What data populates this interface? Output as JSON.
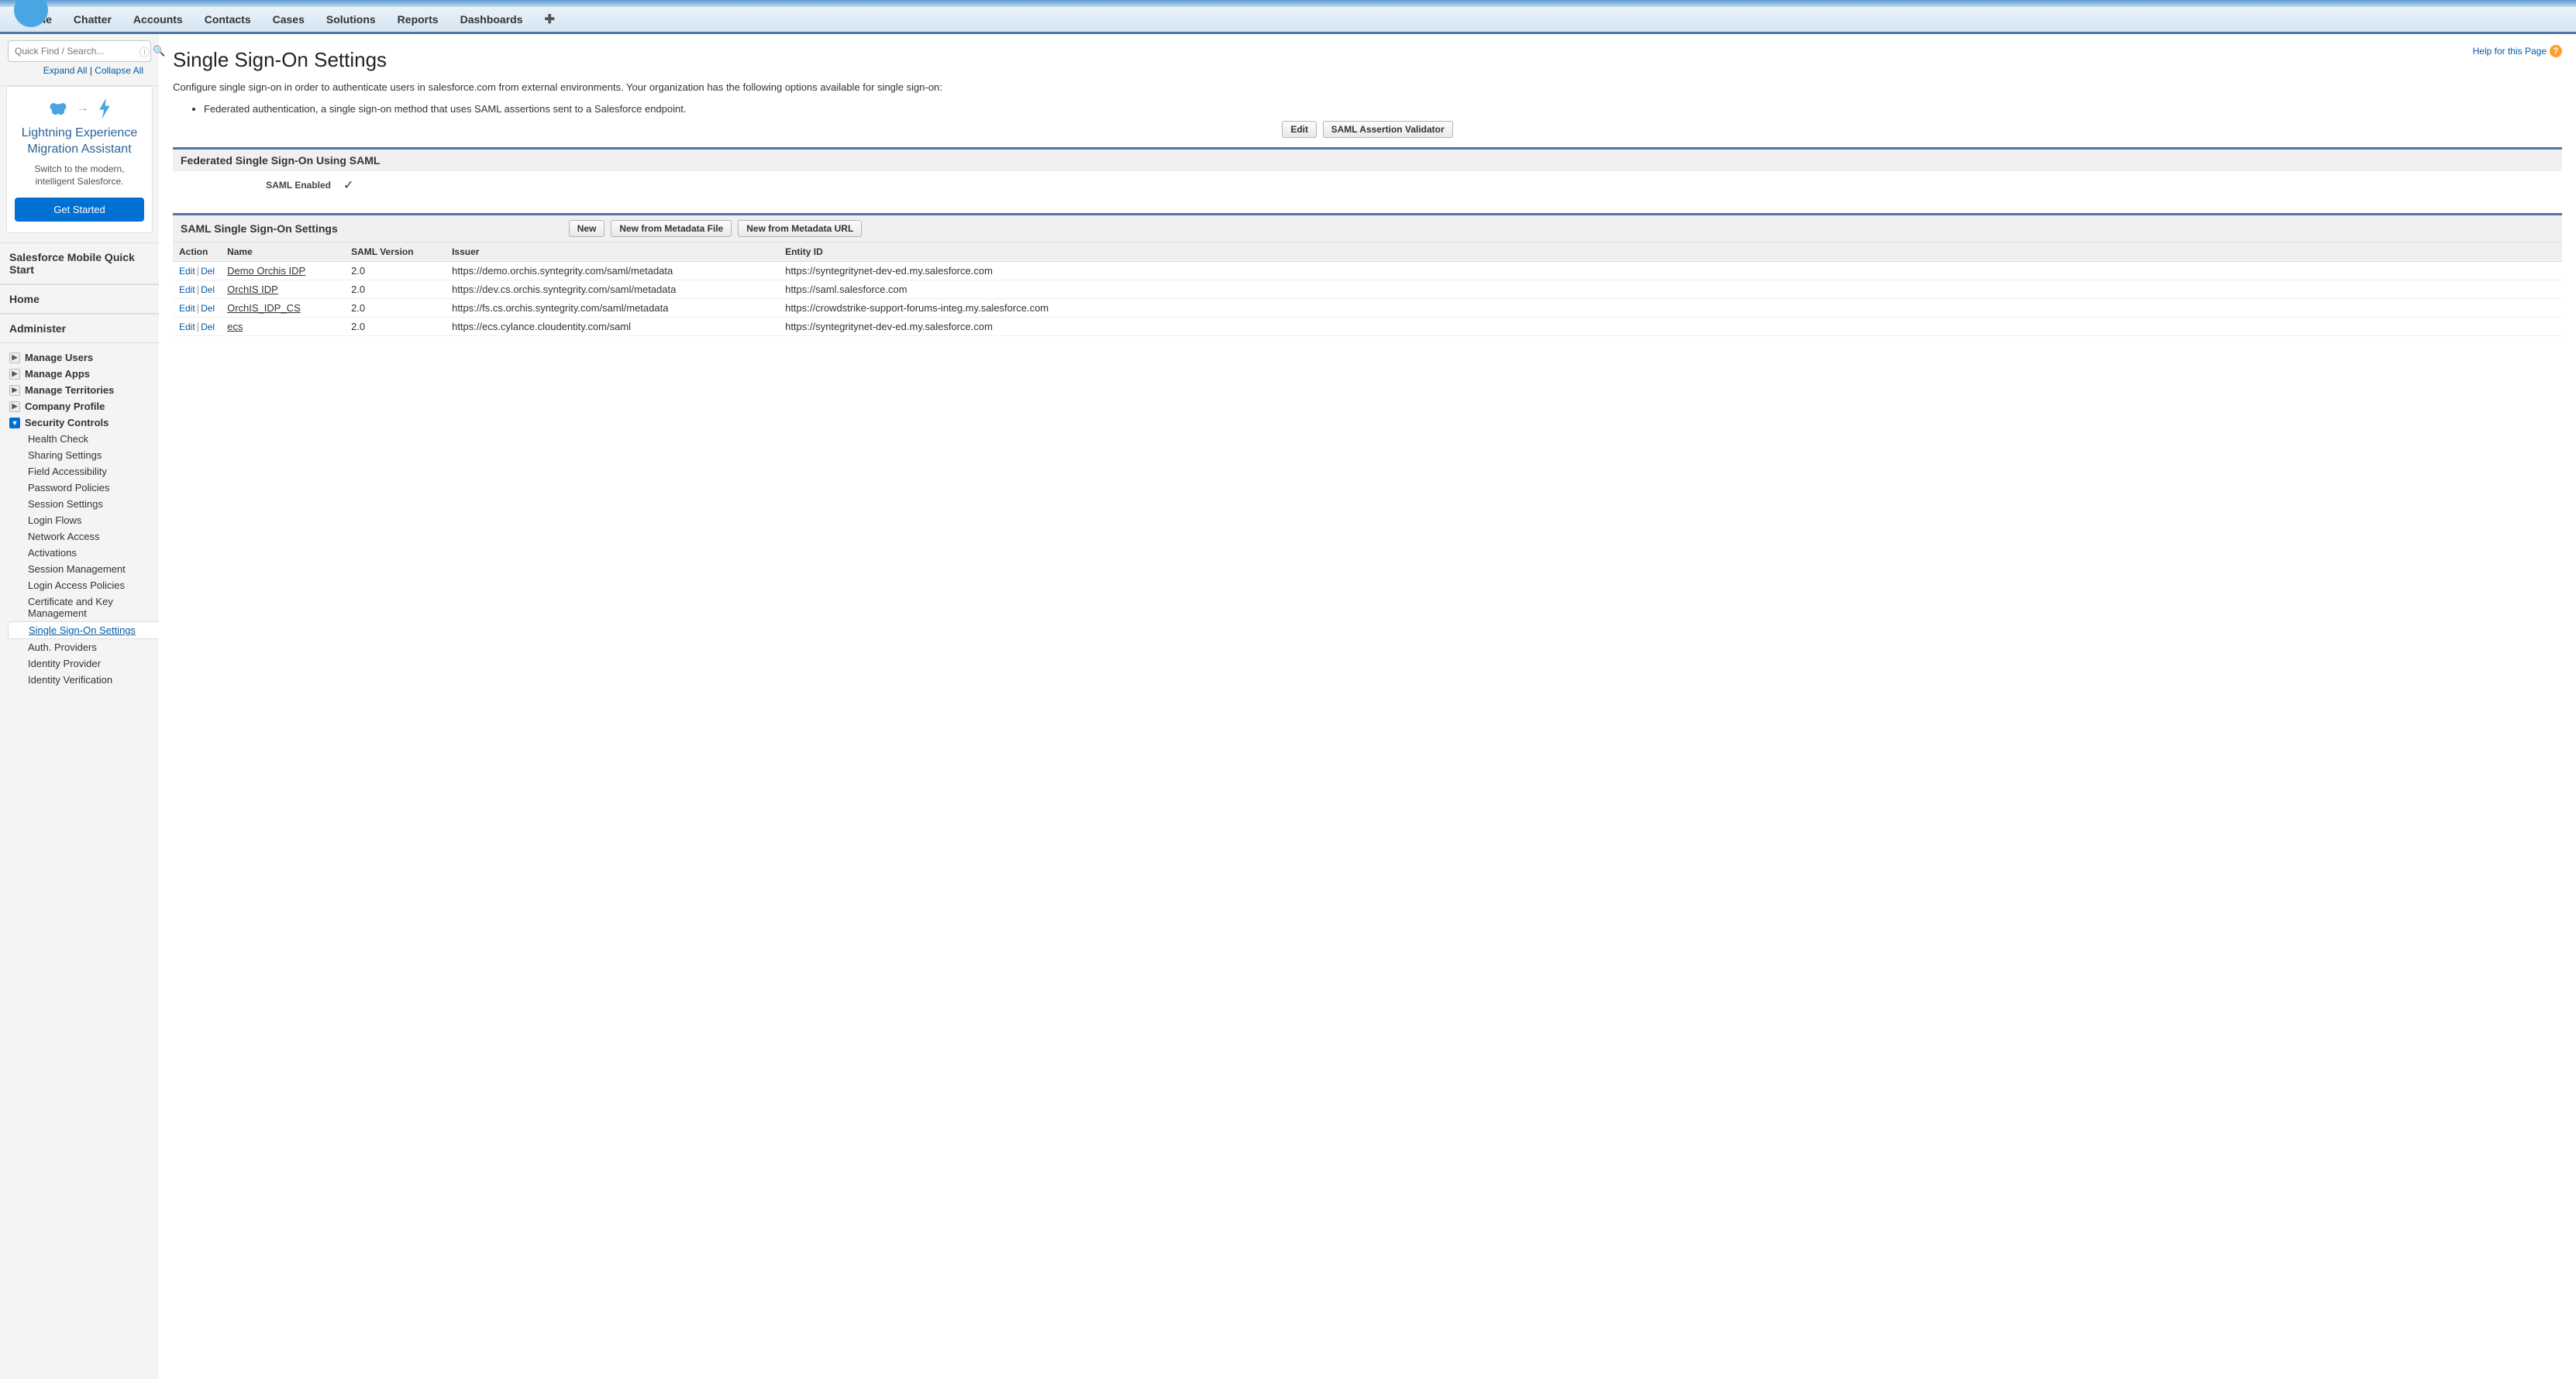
{
  "nav": {
    "tabs": [
      "Home",
      "Chatter",
      "Accounts",
      "Contacts",
      "Cases",
      "Solutions",
      "Reports",
      "Dashboards"
    ]
  },
  "sidebar": {
    "search_placeholder": "Quick Find / Search...",
    "expand": "Expand All",
    "collapse": "Collapse All",
    "migration": {
      "title": "Lightning Experience Migration Assistant",
      "subtitle": "Switch to the modern, intelligent Salesforce.",
      "button": "Get Started"
    },
    "mobile_quick": "Salesforce Mobile Quick Start",
    "home": "Home",
    "administer": "Administer",
    "tree": [
      {
        "label": "Manage Users",
        "open": false
      },
      {
        "label": "Manage Apps",
        "open": false
      },
      {
        "label": "Manage Territories",
        "open": false
      },
      {
        "label": "Company Profile",
        "open": false
      },
      {
        "label": "Security Controls",
        "open": true,
        "children": [
          "Health Check",
          "Sharing Settings",
          "Field Accessibility",
          "Password Policies",
          "Session Settings",
          "Login Flows",
          "Network Access",
          "Activations",
          "Session Management",
          "Login Access Policies",
          "Certificate and Key Management",
          "Single Sign-On Settings",
          "Auth. Providers",
          "Identity Provider",
          "Identity Verification"
        ],
        "active_child": "Single Sign-On Settings"
      }
    ]
  },
  "page": {
    "title": "Single Sign-On Settings",
    "help": "Help for this Page",
    "intro1": "Configure single sign-on in order to authenticate users in salesforce.com from external environments. Your organization has the following options available for single sign-on:",
    "bullet1": "Federated authentication, a single sign-on method that uses SAML assertions sent to a Salesforce endpoint.",
    "buttons": {
      "edit": "Edit",
      "validator": "SAML Assertion Validator"
    },
    "fed_heading": "Federated Single Sign-On Using SAML",
    "saml_enabled_label": "SAML Enabled",
    "saml_table_heading": "SAML Single Sign-On Settings",
    "table_buttons": {
      "new": "New",
      "from_file": "New from Metadata File",
      "from_url": "New from Metadata URL"
    },
    "columns": {
      "action": "Action",
      "name": "Name",
      "version": "SAML Version",
      "issuer": "Issuer",
      "entity": "Entity ID"
    },
    "row_actions": {
      "edit": "Edit",
      "del": "Del"
    },
    "rows": [
      {
        "name": "Demo Orchis IDP",
        "version": "2.0",
        "issuer": "https://demo.orchis.syntegrity.com/saml/metadata",
        "entity": "https://syntegritynet-dev-ed.my.salesforce.com"
      },
      {
        "name": "OrchIS IDP",
        "version": "2.0",
        "issuer": "https://dev.cs.orchis.syntegrity.com/saml/metadata",
        "entity": "https://saml.salesforce.com"
      },
      {
        "name": "OrchIS_IDP_CS",
        "version": "2.0",
        "issuer": "https://fs.cs.orchis.syntegrity.com/saml/metadata",
        "entity": "https://crowdstrike-support-forums-integ.my.salesforce.com"
      },
      {
        "name": "ecs",
        "version": "2.0",
        "issuer": "https://ecs.cylance.cloudentity.com/saml",
        "entity": "https://syntegritynet-dev-ed.my.salesforce.com"
      }
    ]
  }
}
